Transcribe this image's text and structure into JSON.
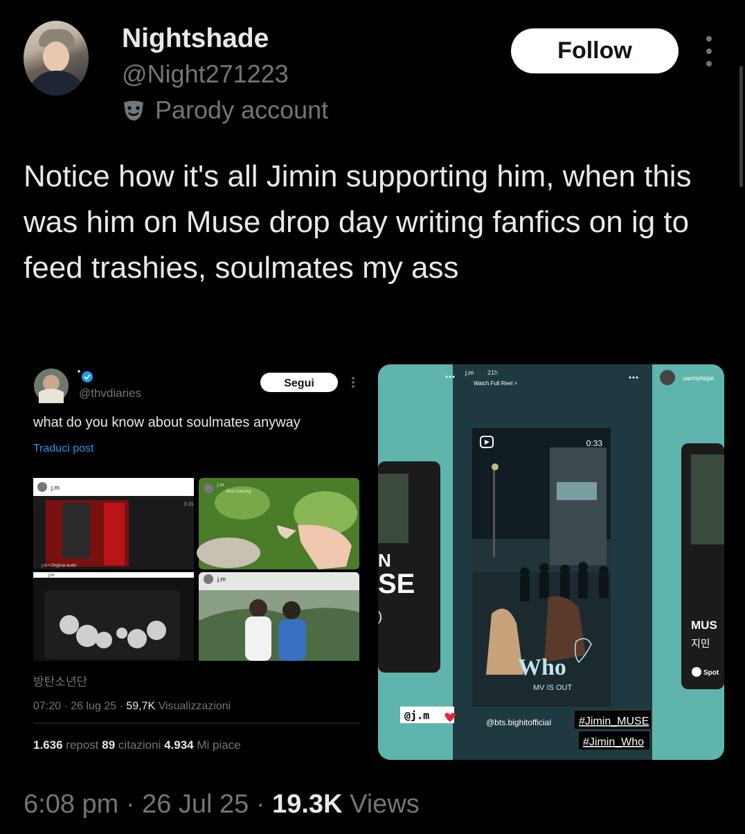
{
  "post": {
    "author_name": "Nightshade",
    "author_handle": "@Night271223",
    "parody_label": "Parody account",
    "follow_label": "Follow",
    "text": "Notice how it's all Jimin supporting him, when this was him on Muse drop day writing fanfics on ig to feed trashies, soulmates my ass",
    "time": "6:08 pm",
    "date": "26 Jul 25",
    "views_count": "19.3K",
    "views_label": "Views",
    "sep": "·"
  },
  "quoted": {
    "handle": "@thvdiaries",
    "follow_label": "Segui",
    "text": "what do you know about soulmates anyway",
    "translate_label": "Traduci post",
    "caption": "방탄소년단",
    "meta_time": "07:20 · 26 lug 25 · ",
    "meta_views": "59,7K",
    "meta_views_label": " Visualizzazioni",
    "reposts_count": "1.636",
    "reposts_label": "repost",
    "quotes_count": "89",
    "quotes_label": "citazioni",
    "likes_count": "4.934",
    "likes_label": "Mi piace",
    "tiles": [
      {
        "user": "j.m",
        "extra": "0 21",
        "audio": "j.m • Original audio"
      },
      {
        "user": "j.m",
        "sub": "Slow Dancing"
      },
      {
        "user": "j.m"
      },
      {
        "user": "j.m"
      }
    ]
  },
  "story": {
    "user": "j.m",
    "time": "21h",
    "reel_label": "Watch Full Reel >",
    "right_user": "uarmyhope",
    "timer": "0:33",
    "who_title": "Who",
    "mv_label": "MV IS OUT",
    "tag_jm": "@j.m",
    "credit": "@bts.bighitofficial",
    "hashtag1": "#Jimin_MUSE",
    "hashtag2": "#Jimin_Who",
    "left_letters1": "N",
    "left_letters2": "SE",
    "right_title": "MUS",
    "right_korean": "지민",
    "right_spotify": "Spot"
  },
  "colors": {
    "bg": "#000000",
    "text": "#e7e9ea",
    "muted": "#71767b",
    "teal": "#5fb5ad",
    "link": "#1d9bf0"
  }
}
